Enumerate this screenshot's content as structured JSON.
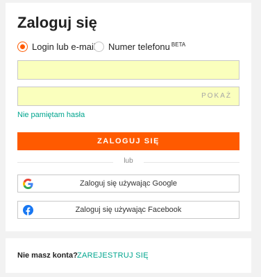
{
  "login": {
    "title": "Zaloguj się",
    "radio_options": [
      {
        "label": "Login lub e-mail",
        "selected": true
      },
      {
        "label": "Numer telefonu",
        "badge": "BETA",
        "selected": false
      }
    ],
    "login_field": {
      "value": "",
      "placeholder": ""
    },
    "password_field": {
      "value": "",
      "placeholder": "",
      "show_label": "POKAŻ"
    },
    "forgot_link": "Nie pamiętam hasła",
    "submit_label": "ZALOGUJ SIĘ",
    "divider_text": "lub",
    "google_button": "Zaloguj się używając Google",
    "facebook_button": "Zaloguj się używając Facebook"
  },
  "register": {
    "prompt": "Nie masz konta?",
    "link": "ZAREJESTRUJ SIĘ"
  },
  "colors": {
    "accent": "#ff5a00",
    "link": "#00a58e",
    "autofill": "#faffbd",
    "facebook": "#1877f2"
  }
}
